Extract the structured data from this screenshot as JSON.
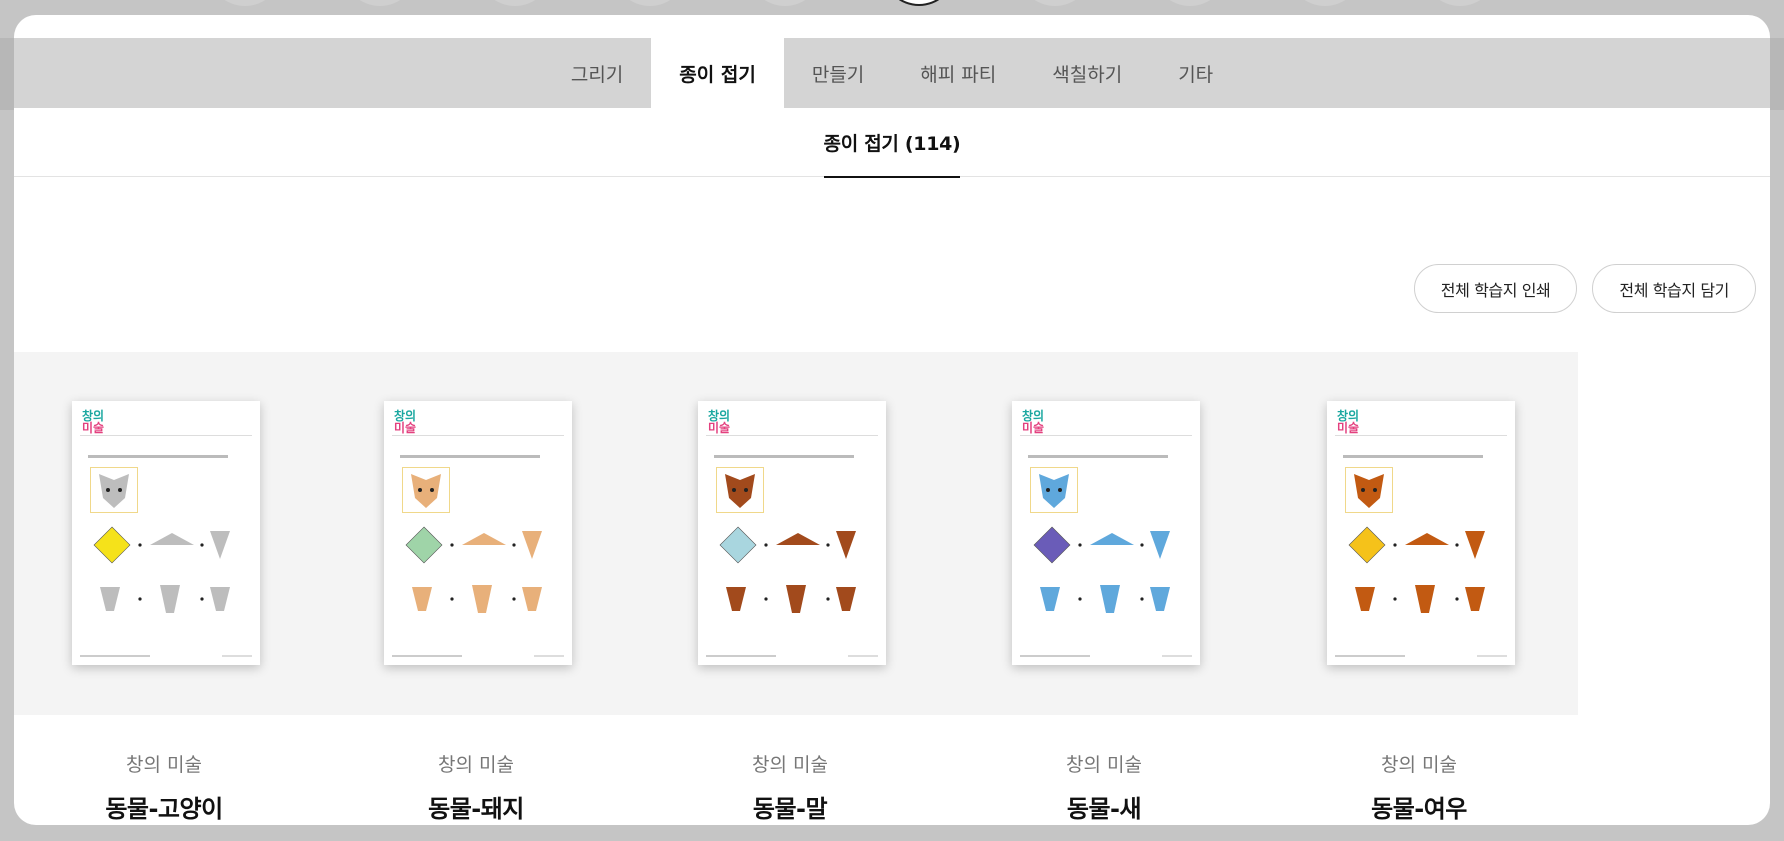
{
  "tabs": [
    {
      "label": "그리기",
      "active": false
    },
    {
      "label": "종이 접기",
      "active": true
    },
    {
      "label": "만들기",
      "active": false
    },
    {
      "label": "해피 파티",
      "active": false
    },
    {
      "label": "색칠하기",
      "active": false
    },
    {
      "label": "기타",
      "active": false
    }
  ],
  "subtab": {
    "label": "종이 접기 (114)"
  },
  "actions": {
    "print_all": "전체 학습지 인쇄",
    "save_all": "전체 학습지 담기"
  },
  "items": [
    {
      "category": "창의 미술",
      "title": "동물-고양이",
      "color": "#f5e21a",
      "accent": "#bdbdbd"
    },
    {
      "category": "창의 미술",
      "title": "동물-돼지",
      "color": "#9fd4a8",
      "accent": "#e8b07a"
    },
    {
      "category": "창의 미술",
      "title": "동물-말",
      "color": "#a9d6df",
      "accent": "#a24a1c"
    },
    {
      "category": "창의 미술",
      "title": "동물-새",
      "color": "#6a5cb8",
      "accent": "#5fa8dc"
    },
    {
      "category": "창의 미술",
      "title": "동물-여우",
      "color": "#f5c21a",
      "accent": "#c25a12"
    }
  ]
}
